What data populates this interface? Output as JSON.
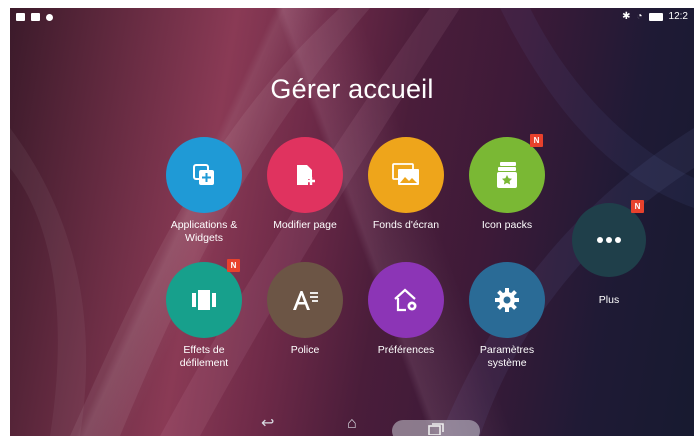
{
  "status_bar": {
    "time": "12:2"
  },
  "page_title": "Gérer accueil",
  "tiles": {
    "apps_widgets": {
      "label": "Applications &\nWidgets",
      "color": "#1f9ad6",
      "icon": "add-widget-icon"
    },
    "modifier_page": {
      "label": "Modifier page",
      "color": "#e0335f",
      "icon": "edit-page-icon"
    },
    "fonds_ecran": {
      "label": "Fonds d'écran",
      "color": "#eea51b",
      "icon": "wallpaper-icon"
    },
    "icon_packs": {
      "label": "Icon packs",
      "color": "#7ab834",
      "icon": "icon-pack-icon",
      "badge": "N"
    },
    "effets": {
      "label": "Effets de\ndéfilement",
      "color": "#17a08c",
      "icon": "scroll-effect-icon",
      "badge": "N"
    },
    "police": {
      "label": "Police",
      "color": "#6c5545",
      "icon": "font-icon"
    },
    "preferences": {
      "label": "Préférences",
      "color": "#8c35b6",
      "icon": "home-settings-icon"
    },
    "parametres": {
      "label": "Paramètres\nsystème",
      "color": "#2a6b96",
      "icon": "gear-icon"
    },
    "plus": {
      "label": "Plus",
      "color": "#1f3f4a",
      "icon": "more-dots-icon",
      "badge": "N"
    }
  },
  "nav_bar": {
    "back_icon": "back-icon",
    "home_icon": "home-icon",
    "recents_icon": "recent-apps-icon"
  }
}
